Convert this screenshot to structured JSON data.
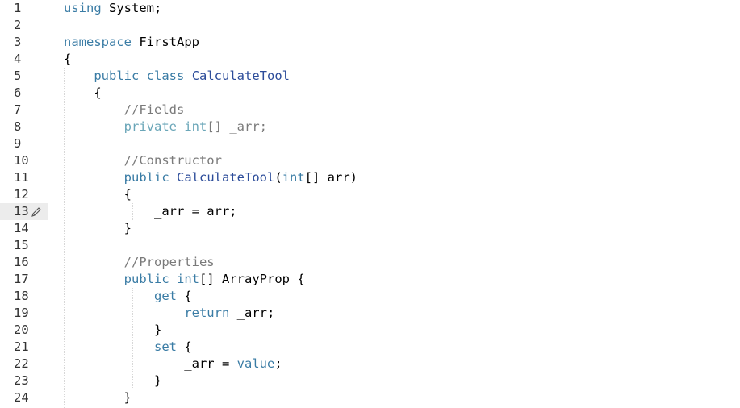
{
  "editor": {
    "language": "C#",
    "current_line": 13,
    "colors": {
      "keyword": "#3a7ca5",
      "keyword_faded": "#6aa6b8",
      "type": "#2c4c9a",
      "comment": "#7a7a7a",
      "plain": "#000000",
      "line_number": "#333333",
      "current_line_bg": "#ececec"
    },
    "gutter_icon": "pencil-icon",
    "lines": [
      {
        "n": "1",
        "tokens": [
          [
            "kw",
            "using"
          ],
          [
            "plain",
            " System;"
          ]
        ]
      },
      {
        "n": "2",
        "tokens": []
      },
      {
        "n": "3",
        "tokens": [
          [
            "kw",
            "namespace"
          ],
          [
            "plain",
            " FirstApp"
          ]
        ]
      },
      {
        "n": "4",
        "tokens": [
          [
            "plain",
            "{"
          ]
        ]
      },
      {
        "n": "5",
        "tokens": [
          [
            "plain",
            "    "
          ],
          [
            "kw",
            "public"
          ],
          [
            "plain",
            " "
          ],
          [
            "kw",
            "class"
          ],
          [
            "plain",
            " "
          ],
          [
            "type",
            "CalculateTool"
          ]
        ]
      },
      {
        "n": "6",
        "tokens": [
          [
            "plain",
            "    {"
          ]
        ]
      },
      {
        "n": "7",
        "tokens": [
          [
            "plain",
            "        "
          ],
          [
            "cmt",
            "//Fields"
          ]
        ]
      },
      {
        "n": "8",
        "tokens": [
          [
            "plain",
            "        "
          ],
          [
            "kw2",
            "private"
          ],
          [
            "plain",
            " "
          ],
          [
            "kw2",
            "int"
          ],
          [
            "cmt",
            "[] _arr;"
          ]
        ]
      },
      {
        "n": "9",
        "tokens": []
      },
      {
        "n": "10",
        "tokens": [
          [
            "plain",
            "        "
          ],
          [
            "cmt",
            "//Constructor"
          ]
        ]
      },
      {
        "n": "11",
        "tokens": [
          [
            "plain",
            "        "
          ],
          [
            "kw",
            "public"
          ],
          [
            "plain",
            " "
          ],
          [
            "type",
            "CalculateTool"
          ],
          [
            "plain",
            "("
          ],
          [
            "kw",
            "int"
          ],
          [
            "plain",
            "[] arr)"
          ]
        ]
      },
      {
        "n": "12",
        "tokens": [
          [
            "plain",
            "        {"
          ]
        ]
      },
      {
        "n": "13",
        "tokens": [
          [
            "plain",
            "            _arr = arr;"
          ]
        ]
      },
      {
        "n": "14",
        "tokens": [
          [
            "plain",
            "        }"
          ]
        ]
      },
      {
        "n": "15",
        "tokens": []
      },
      {
        "n": "16",
        "tokens": [
          [
            "plain",
            "        "
          ],
          [
            "cmt",
            "//Properties"
          ]
        ]
      },
      {
        "n": "17",
        "tokens": [
          [
            "plain",
            "        "
          ],
          [
            "kw",
            "public"
          ],
          [
            "plain",
            " "
          ],
          [
            "kw",
            "int"
          ],
          [
            "plain",
            "[] ArrayProp {"
          ]
        ]
      },
      {
        "n": "18",
        "tokens": [
          [
            "plain",
            "            "
          ],
          [
            "kw",
            "get"
          ],
          [
            "plain",
            " {"
          ]
        ]
      },
      {
        "n": "19",
        "tokens": [
          [
            "plain",
            "                "
          ],
          [
            "kw",
            "return"
          ],
          [
            "plain",
            " _arr;"
          ]
        ]
      },
      {
        "n": "20",
        "tokens": [
          [
            "plain",
            "            }"
          ]
        ]
      },
      {
        "n": "21",
        "tokens": [
          [
            "plain",
            "            "
          ],
          [
            "kw",
            "set"
          ],
          [
            "plain",
            " {"
          ]
        ]
      },
      {
        "n": "22",
        "tokens": [
          [
            "plain",
            "                _arr = "
          ],
          [
            "kw",
            "value"
          ],
          [
            "plain",
            ";"
          ]
        ]
      },
      {
        "n": "23",
        "tokens": [
          [
            "plain",
            "            }"
          ]
        ]
      },
      {
        "n": "24",
        "tokens": [
          [
            "plain",
            "        }"
          ]
        ]
      }
    ]
  }
}
